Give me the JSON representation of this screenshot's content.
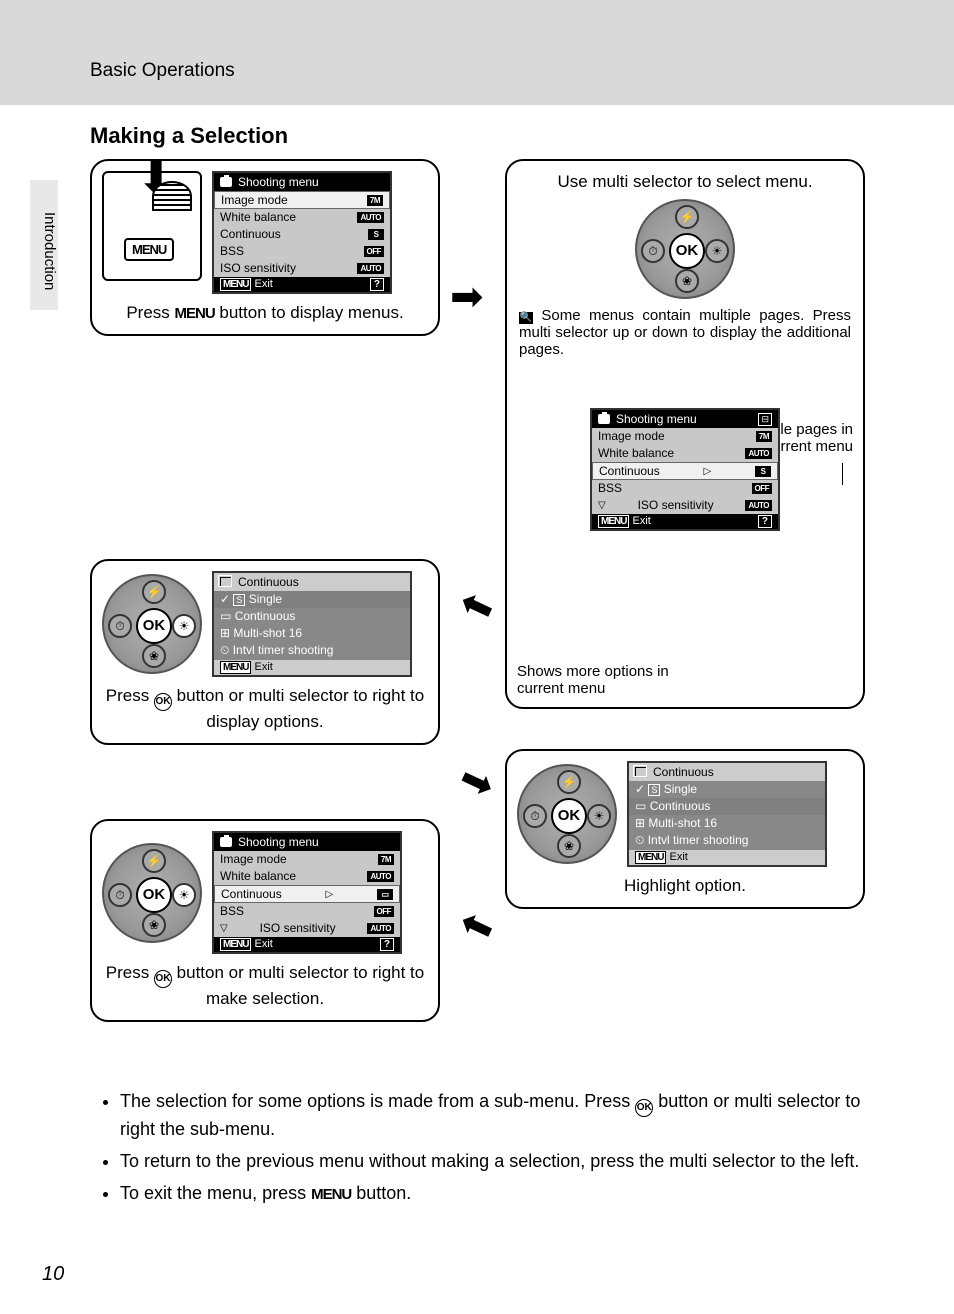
{
  "header": {
    "chapter": "Basic Operations"
  },
  "sidebar": {
    "tab": "Introduction"
  },
  "section": {
    "title": "Making a Selection"
  },
  "page_number": "10",
  "glyphs": {
    "menu": "MENU",
    "ok": "OK",
    "exit": "Exit",
    "question": "?",
    "camera": "◙",
    "flash": "⚡",
    "timer": "⏱",
    "flower": "❀",
    "exp": "☀"
  },
  "step1": {
    "caption_pre": "Press ",
    "caption_post": " button to display menus.",
    "lcd": {
      "title": "Shooting menu",
      "items": [
        {
          "label": "Image mode",
          "tag": "7M",
          "sel": true
        },
        {
          "label": "White balance",
          "tag": "AUTO"
        },
        {
          "label": "Continuous",
          "tag": "S"
        },
        {
          "label": "BSS",
          "tag": "OFF"
        },
        {
          "label": "ISO sensitivity",
          "tag": "AUTO"
        }
      ]
    }
  },
  "step2": {
    "caption_top": "Use multi selector to select menu.",
    "note_pre": " Some menus contain multiple pages. Press multi selector up or down to display the additional pages.",
    "annot_pages": "Shows multiple pages in current menu",
    "annot_more": "Shows more options in current menu",
    "lcd": {
      "title": "Shooting menu",
      "items": [
        {
          "label": "Image mode",
          "tag": "7M"
        },
        {
          "label": "White balance",
          "tag": "AUTO"
        },
        {
          "label": "Continuous",
          "tag": "S",
          "sel": true
        },
        {
          "label": "BSS",
          "tag": "OFF"
        },
        {
          "label": "ISO sensitivity",
          "tag": "AUTO"
        }
      ]
    }
  },
  "step3": {
    "caption_pre": "Press ",
    "caption_mid": " button or multi selector to right to display options.",
    "lcd": {
      "title": "Continuous",
      "items": [
        {
          "label": "Single",
          "hl": true,
          "icon": "S"
        },
        {
          "label": "Continuous",
          "icon": "▭"
        },
        {
          "label": "Multi-shot 16",
          "icon": "⊞"
        },
        {
          "label": "Intvl timer shooting",
          "icon": "⏲"
        }
      ]
    }
  },
  "step4": {
    "caption": "Highlight option.",
    "lcd": {
      "title": "Continuous",
      "items": [
        {
          "label": "Single",
          "icon": "S"
        },
        {
          "label": "Continuous",
          "hl": true,
          "icon": "▭"
        },
        {
          "label": "Multi-shot 16",
          "icon": "⊞"
        },
        {
          "label": "Intvl timer shooting",
          "icon": "⏲"
        }
      ]
    }
  },
  "step5": {
    "caption_pre": "Press ",
    "caption_mid": " button or multi selector to right to make selection.",
    "lcd": {
      "title": "Shooting menu",
      "items": [
        {
          "label": "Image mode",
          "tag": "7M"
        },
        {
          "label": "White balance",
          "tag": "AUTO"
        },
        {
          "label": "Continuous",
          "tag": "▭",
          "sel": true
        },
        {
          "label": "BSS",
          "tag": "OFF"
        },
        {
          "label": "ISO sensitivity",
          "tag": "AUTO"
        }
      ]
    }
  },
  "bullets": {
    "b1_pre": "The selection for some options is made from a sub-menu. Press ",
    "b1_post": " button or multi selector to right the sub-menu.",
    "b2": "To return to the previous menu without making a selection, press the multi selector to the left.",
    "b3_pre": "To exit the menu, press ",
    "b3_post": " button."
  }
}
